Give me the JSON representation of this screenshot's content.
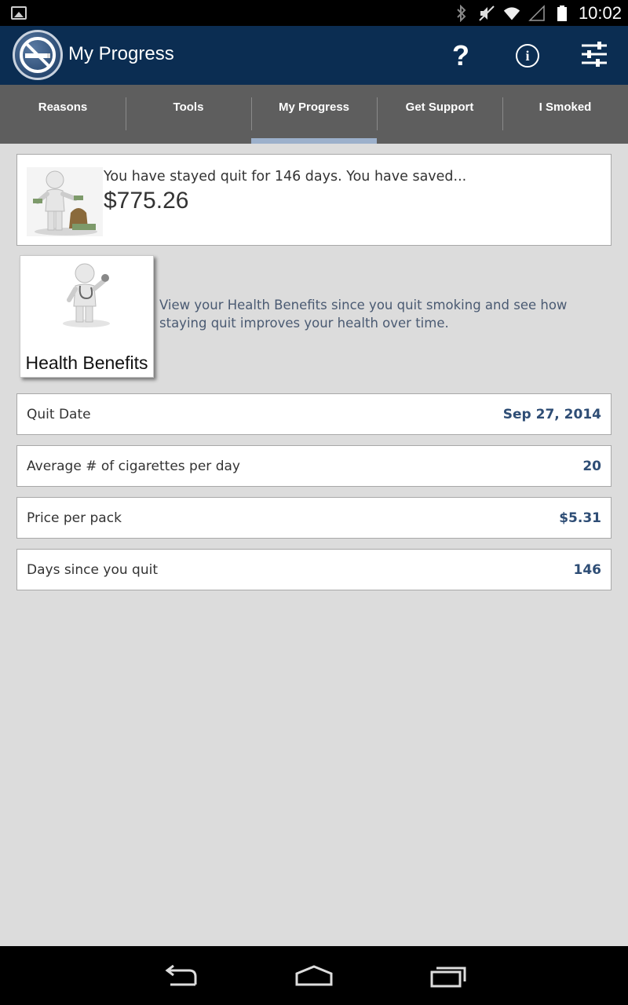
{
  "status_bar": {
    "time": "10:02",
    "icons": [
      "image-icon",
      "bluetooth-icon",
      "mute-icon",
      "wifi-icon",
      "signal-icon",
      "battery-icon"
    ]
  },
  "app_bar": {
    "title": "My Progress",
    "logo": "no-smoking-logo",
    "actions": [
      "help-icon",
      "info-icon",
      "settings-sliders-icon"
    ],
    "help_glyph": "?",
    "info_glyph": "i"
  },
  "tabs": [
    {
      "label": "Reasons",
      "active": false
    },
    {
      "label": "Tools",
      "active": false
    },
    {
      "label": "My Progress",
      "active": true
    },
    {
      "label": "Get Support",
      "active": false
    },
    {
      "label": "I Smoked",
      "active": false
    }
  ],
  "savings": {
    "text": "You have stayed quit for 146 days.  You have saved...",
    "amount": "$775.26",
    "image": "person-with-money-icon"
  },
  "health_benefits": {
    "label": "Health Benefits",
    "image": "person-with-stethoscope-icon",
    "description": "View your Health Benefits since you quit smoking and see how staying quit improves your health over time."
  },
  "stats": [
    {
      "label": "Quit Date",
      "value": "Sep 27, 2014"
    },
    {
      "label": "Average # of cigarettes per day",
      "value": "20"
    },
    {
      "label": "Price per pack",
      "value": "$5.31"
    },
    {
      "label": "Days since you quit",
      "value": "146"
    }
  ],
  "nav_bar": [
    "back-icon",
    "home-icon",
    "recents-icon"
  ],
  "colors": {
    "app_bar": "#0b2d52",
    "tab_bar": "#5e5e5e",
    "tab_indicator": "#9cb0cb",
    "value_text": "#2e4d75",
    "background": "#dcdcdc"
  }
}
